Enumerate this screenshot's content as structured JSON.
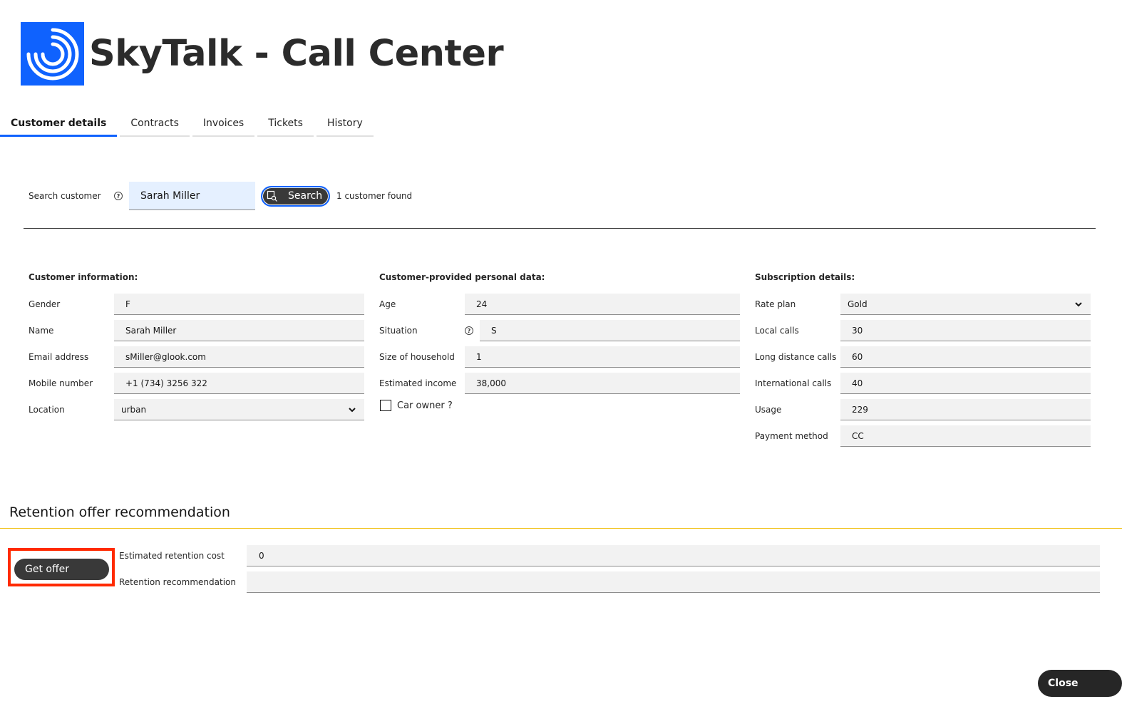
{
  "app": {
    "title": "SkyTalk - Call Center",
    "logo": "skytalk-logo"
  },
  "tabs": [
    {
      "label": "Customer details",
      "active": true
    },
    {
      "label": "Contracts",
      "active": false
    },
    {
      "label": "Invoices",
      "active": false
    },
    {
      "label": "Tickets",
      "active": false
    },
    {
      "label": "History",
      "active": false
    }
  ],
  "search": {
    "label": "Search customer",
    "help_icon": "help-icon",
    "value": "Sarah Miller",
    "button_label": "Search",
    "button_icon": "search-icon",
    "result_text": "1 customer found"
  },
  "customer_info": {
    "title": "Customer information:",
    "fields": [
      {
        "label": "Gender",
        "value": "F"
      },
      {
        "label": "Name",
        "value": "Sarah Miller"
      },
      {
        "label": "Email address",
        "value": "sMiller@glook.com"
      },
      {
        "label": "Mobile number",
        "value": "+1 (734) 3256 322"
      },
      {
        "label": "Location",
        "value": "urban",
        "type": "select"
      }
    ]
  },
  "personal_data": {
    "title": "Customer-provided personal data:",
    "fields": [
      {
        "label": "Age",
        "value": "24"
      },
      {
        "label": "Situation",
        "value": "S",
        "help_icon": "help-icon"
      },
      {
        "label": "Size of household",
        "value": "1"
      },
      {
        "label": "Estimated income",
        "value": "38,000"
      }
    ],
    "car_owner": {
      "label": "Car owner ?",
      "checked": false
    }
  },
  "subscription": {
    "title": "Subscription details:",
    "fields": [
      {
        "label": "Rate plan",
        "value": "Gold",
        "type": "select"
      },
      {
        "label": "Local calls",
        "value": "30"
      },
      {
        "label": "Long distance calls",
        "value": "60"
      },
      {
        "label": "International calls",
        "value": "40"
      },
      {
        "label": "Usage",
        "value": "229"
      },
      {
        "label": "Payment method",
        "value": "CC"
      }
    ]
  },
  "retention": {
    "title": "Retention offer recommendation",
    "get_offer_label": "Get offer",
    "cost_label": "Estimated retention cost",
    "cost_value": "0",
    "recommendation_label": "Retention recommendation",
    "recommendation_value": ""
  },
  "footer": {
    "close_label": "Close"
  },
  "colors": {
    "accent": "#0f62fe",
    "button": "#393939",
    "highlight": "#ff2a00",
    "section_rule": "#f1c21b"
  }
}
